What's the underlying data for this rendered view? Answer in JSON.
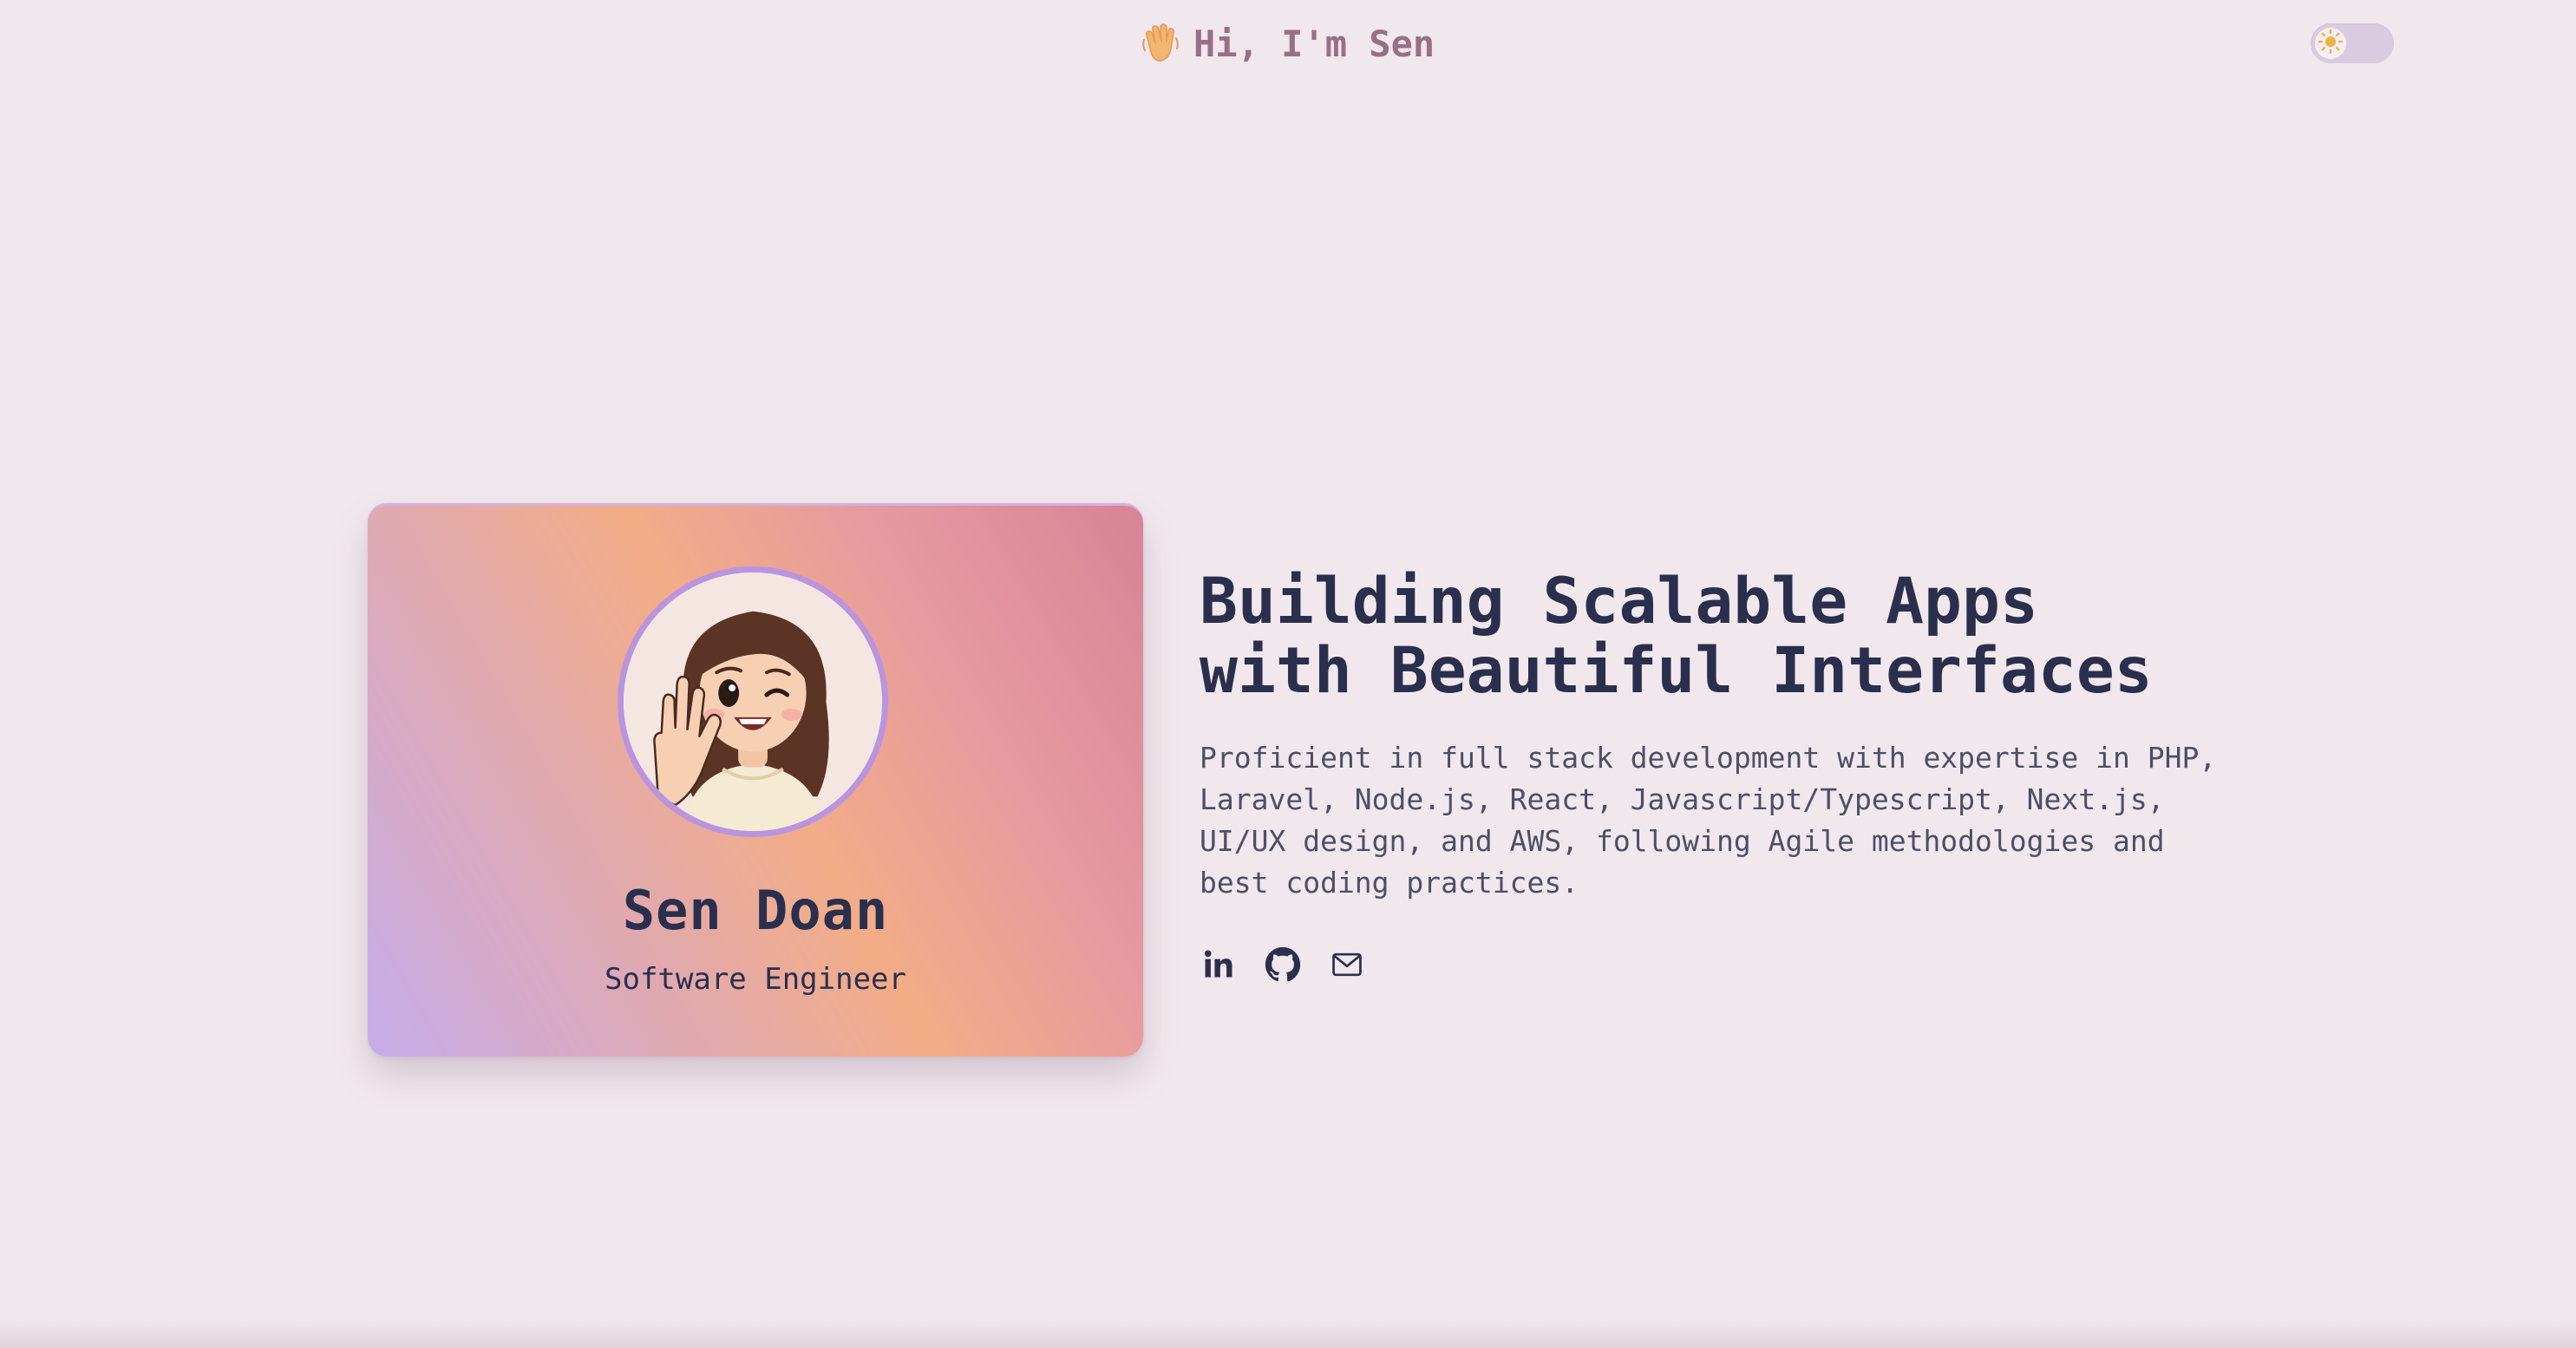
{
  "header": {
    "greeting": "Hi, I'm Sen",
    "wave_icon": "waving-hand-icon",
    "theme_toggle_icon": "sun-icon"
  },
  "profile_card": {
    "name": "Sen Doan",
    "role": "Software Engineer",
    "avatar_icon": "avatar-illustration"
  },
  "hero": {
    "title": "Building Scalable Apps\nwith Beautiful Interfaces",
    "description": "Proficient in full stack development with expertise in PHP, Laravel, Node.js, React, Javascript/Typescript, Next.js, UI/UX design, and AWS, following Agile methodologies and best coding practices."
  },
  "social_links": [
    {
      "icon": "linkedin-icon"
    },
    {
      "icon": "github-icon"
    },
    {
      "icon": "mail-icon"
    }
  ],
  "colors": {
    "background": "#f1e8ed",
    "heading": "#2b2f4e",
    "header_text": "#9a6f86",
    "avatar_border": "#b995df",
    "toggle_bg": "#d9cce0",
    "sun": "#f0b43c"
  }
}
